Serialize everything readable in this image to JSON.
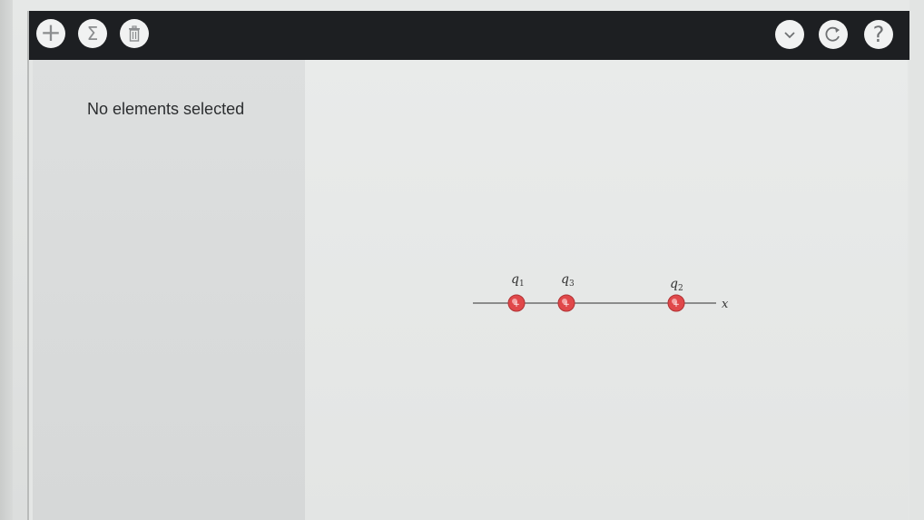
{
  "toolbar": {
    "left_buttons": [
      {
        "name": "add",
        "icon": "plus-icon"
      },
      {
        "name": "sum",
        "icon": "sigma-icon",
        "glyph": "Σ"
      },
      {
        "name": "delete",
        "icon": "trash-icon"
      }
    ],
    "right_buttons": [
      {
        "name": "dropdown",
        "icon": "chevron-down-icon"
      },
      {
        "name": "reset",
        "icon": "reset-icon"
      },
      {
        "name": "help",
        "icon": "help-icon",
        "glyph": "?"
      }
    ],
    "background_color": "#1d1f22"
  },
  "sidebar": {
    "status_text": "No elements selected"
  },
  "figure": {
    "charges": [
      {
        "label": "q",
        "subscript": "1",
        "sign": "+"
      },
      {
        "label": "q",
        "subscript": "3",
        "sign": "+"
      },
      {
        "label": "q",
        "subscript": "2",
        "sign": "+"
      }
    ],
    "axis_label": "x",
    "charge_color": "#e0484a"
  }
}
